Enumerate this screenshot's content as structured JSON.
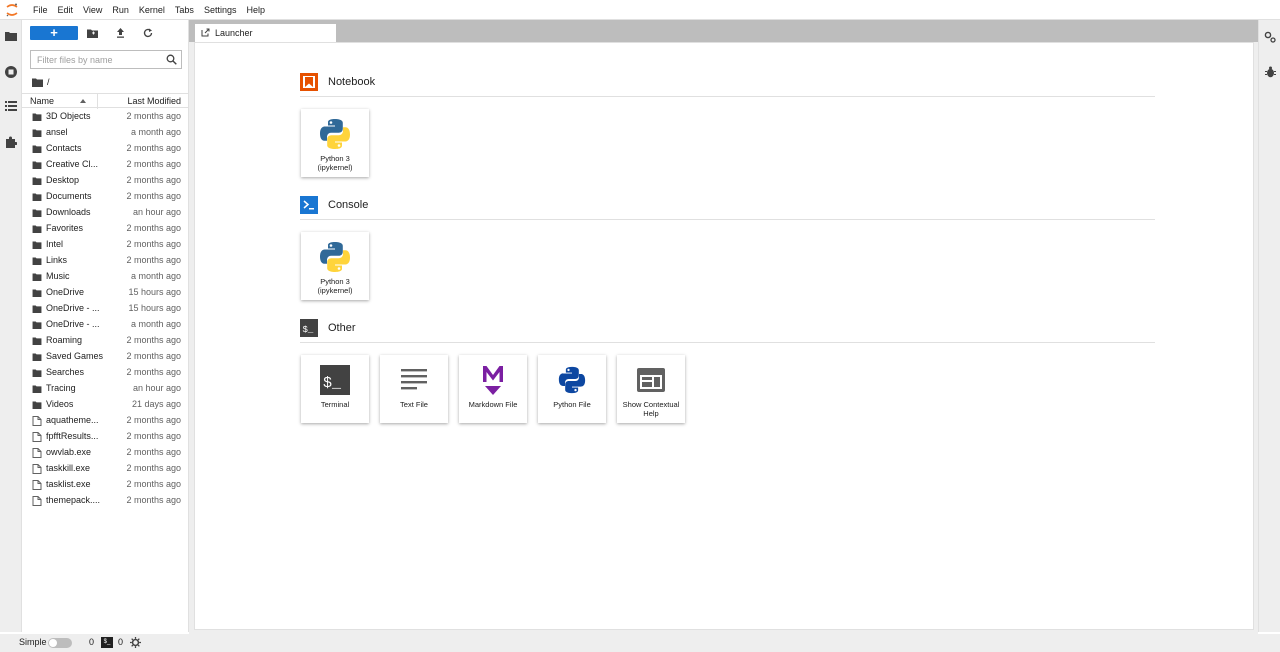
{
  "menubar": {
    "items": [
      "File",
      "Edit",
      "View",
      "Run",
      "Kernel",
      "Tabs",
      "Settings",
      "Help"
    ]
  },
  "filebrowser": {
    "new_button_label": "+",
    "filter_placeholder": "Filter files by name",
    "breadcrumb": "/",
    "col_name": "Name",
    "col_modified": "Last Modified",
    "files": [
      {
        "name": "3D Objects",
        "modified": "2 months ago",
        "type": "folder"
      },
      {
        "name": "ansel",
        "modified": "a month ago",
        "type": "folder"
      },
      {
        "name": "Contacts",
        "modified": "2 months ago",
        "type": "folder"
      },
      {
        "name": "Creative Cl...",
        "modified": "2 months ago",
        "type": "folder"
      },
      {
        "name": "Desktop",
        "modified": "2 months ago",
        "type": "folder"
      },
      {
        "name": "Documents",
        "modified": "2 months ago",
        "type": "folder"
      },
      {
        "name": "Downloads",
        "modified": "an hour ago",
        "type": "folder"
      },
      {
        "name": "Favorites",
        "modified": "2 months ago",
        "type": "folder"
      },
      {
        "name": "Intel",
        "modified": "2 months ago",
        "type": "folder"
      },
      {
        "name": "Links",
        "modified": "2 months ago",
        "type": "folder"
      },
      {
        "name": "Music",
        "modified": "a month ago",
        "type": "folder"
      },
      {
        "name": "OneDrive",
        "modified": "15 hours ago",
        "type": "folder"
      },
      {
        "name": "OneDrive - ...",
        "modified": "15 hours ago",
        "type": "folder"
      },
      {
        "name": "OneDrive - ...",
        "modified": "a month ago",
        "type": "folder"
      },
      {
        "name": "Roaming",
        "modified": "2 months ago",
        "type": "folder"
      },
      {
        "name": "Saved Games",
        "modified": "2 months ago",
        "type": "folder"
      },
      {
        "name": "Searches",
        "modified": "2 months ago",
        "type": "folder"
      },
      {
        "name": "Tracing",
        "modified": "an hour ago",
        "type": "folder"
      },
      {
        "name": "Videos",
        "modified": "21 days ago",
        "type": "folder"
      },
      {
        "name": "aquatheme...",
        "modified": "2 months ago",
        "type": "file"
      },
      {
        "name": "fpfftResults...",
        "modified": "2 months ago",
        "type": "file"
      },
      {
        "name": "owvlab.exe",
        "modified": "2 months ago",
        "type": "file"
      },
      {
        "name": "taskkill.exe",
        "modified": "2 months ago",
        "type": "file"
      },
      {
        "name": "tasklist.exe",
        "modified": "2 months ago",
        "type": "file"
      },
      {
        "name": "themepack....",
        "modified": "2 months ago",
        "type": "file"
      }
    ]
  },
  "tabs": {
    "launcher_label": "Launcher"
  },
  "launcher": {
    "notebook": {
      "title": "Notebook",
      "cards": [
        {
          "label": "Python 3 (ipykernel)",
          "icon": "python-icon"
        }
      ]
    },
    "console": {
      "title": "Console",
      "cards": [
        {
          "label": "Python 3 (ipykernel)",
          "icon": "python-icon"
        }
      ]
    },
    "other": {
      "title": "Other",
      "cards": [
        {
          "label": "Terminal",
          "icon": "terminal-icon"
        },
        {
          "label": "Text File",
          "icon": "text-file-icon"
        },
        {
          "label": "Markdown File",
          "icon": "markdown-icon"
        },
        {
          "label": "Python File",
          "icon": "python-file-icon"
        },
        {
          "label": "Show Contextual Help",
          "icon": "contextual-help-icon"
        }
      ]
    }
  },
  "statusbar": {
    "simple_label": "Simple",
    "kernel_count": "0",
    "terminal_icon_text": "$_",
    "terminal_count": "0"
  },
  "colors": {
    "accent": "#1976d2",
    "notebook_orange": "#e65100",
    "markdown_purple": "#7b1fa2",
    "python_blue": "#306998",
    "python_yellow": "#ffd43b"
  }
}
